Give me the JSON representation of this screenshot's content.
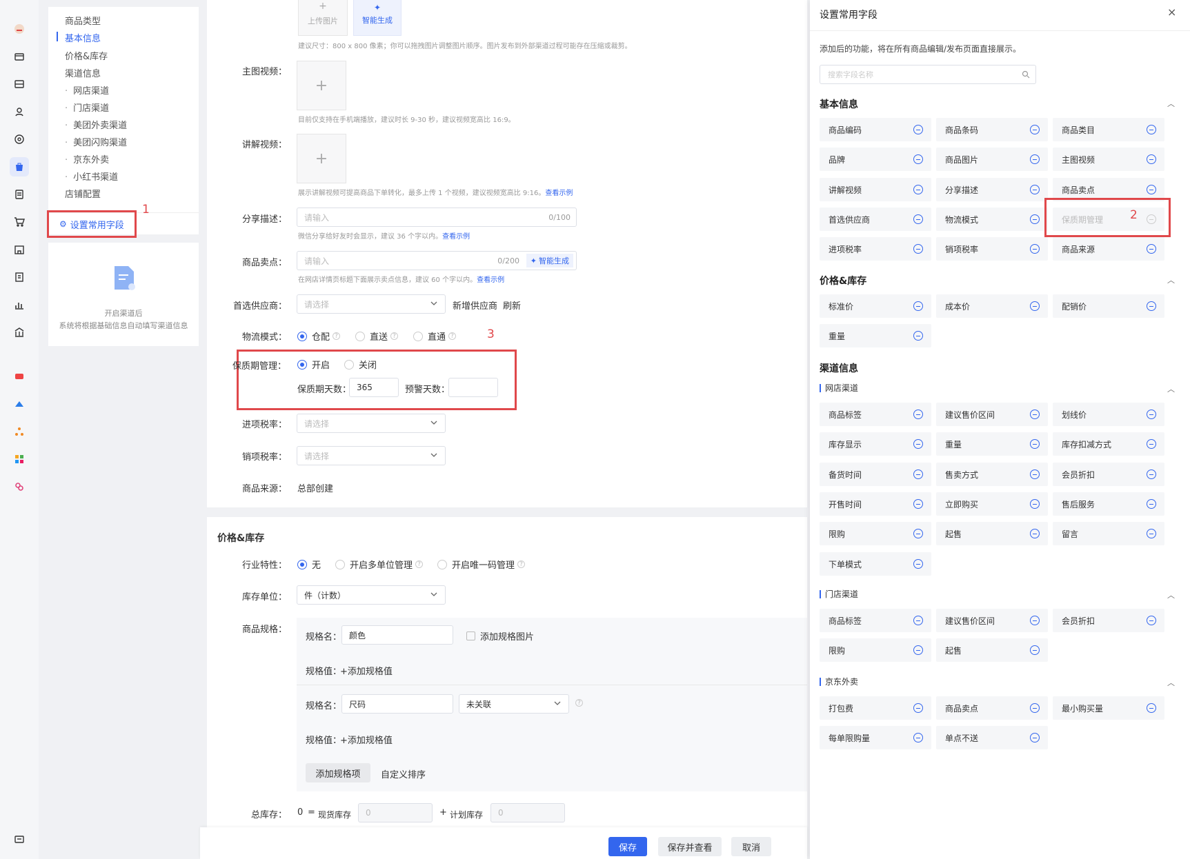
{
  "rail_icons": [
    "avatar",
    "store-icon",
    "shop-icon",
    "user-icon",
    "target-icon",
    "bag-icon",
    "doc-icon",
    "cart-icon",
    "building-icon",
    "receipt-icon",
    "chart-icon",
    "bank-icon",
    "app-red-icon",
    "app-blue-icon",
    "app-orange-icon",
    "app-multi-icon",
    "app-pink-icon",
    "chat-icon"
  ],
  "nav": {
    "items": [
      "商品类型",
      "基本信息",
      "价格&库存",
      "渠道信息"
    ],
    "subitems": [
      "网店渠道",
      "门店渠道",
      "美团外卖渠道",
      "美团闪购渠道",
      "京东外卖",
      "小红书渠道"
    ],
    "last": "店铺配置",
    "set_fields": "设置常用字段",
    "hint_line1": "开启渠道后",
    "hint_line2": "系统将根据基础信息自动填写渠道信息"
  },
  "annotations": {
    "n1": "1",
    "n2": "2",
    "n3": "3"
  },
  "form": {
    "upload_label": "上传图片",
    "ai_gen_label": "智能生成",
    "img_hint": "建议尺寸：800 x 800 像素；你可以拖拽图片调整图片顺序。图片发布到外部渠道过程可能存在压缩或裁剪。",
    "main_video_label": "主图视频：",
    "main_video_hint": "目前仅支持在手机端播放，建议时长 9-30 秒，建议视频宽高比 16:9。",
    "explain_video_label": "讲解视频：",
    "explain_video_hint": "展示讲解视频可提高商品下单转化，最多上传 1 个视频，建议视频宽高比 9:16。",
    "view_example": "查看示例",
    "share_label": "分享描述：",
    "share_placeholder": "请输入",
    "share_count": "0/100",
    "share_hint": "微信分享给好友时会显示，建议 36 个字以内。",
    "selling_label": "商品卖点：",
    "selling_placeholder": "请输入",
    "selling_count": "0/200",
    "selling_ai": "智能生成",
    "selling_hint": "在网店详情页标题下面展示卖点信息，建议 60 个字以内。",
    "supplier_label": "首选供应商：",
    "supplier_placeholder": "请选择",
    "add_supplier": "新增供应商",
    "refresh": "刷新",
    "logistics_label": "物流模式：",
    "logistics_opts": [
      "仓配",
      "直送",
      "直通"
    ],
    "shelf_label": "保质期管理：",
    "shelf_on": "开启",
    "shelf_off": "关闭",
    "shelf_days_label": "保质期天数：",
    "shelf_days_value": "365",
    "warn_days_label": "预警天数：",
    "in_tax_label": "进项税率：",
    "out_tax_label": "销项税率：",
    "tax_placeholder": "请选择",
    "source_label": "商品来源：",
    "source_value": "总部创建"
  },
  "price": {
    "section_title": "价格&库存",
    "industry_label": "行业特性：",
    "industry_opts": [
      "无",
      "开启多单位管理",
      "开启唯一码管理"
    ],
    "unit_label": "库存单位：",
    "unit_value": "件（计数）",
    "spec_label": "商品规格：",
    "spec_name_label": "规格名：",
    "spec1_name": "颜色",
    "add_spec_img": "添加规格图片",
    "spec_value_label": "规格值：",
    "add_spec_value": "+添加规格值",
    "spec2_name": "尺码",
    "spec2_link": "未关联",
    "add_spec_item": "添加规格项",
    "custom_sort": "自定义排序",
    "total_stock_label": "总库存：",
    "total_stock_value": "0",
    "eq": "=",
    "current_stock": "现货库存",
    "plus": "+",
    "planned_stock": "计划库存",
    "zero_placeholder": "0"
  },
  "footer": {
    "save": "保存",
    "save_view": "保存并查看",
    "cancel": "取消"
  },
  "drawer": {
    "title": "设置常用字段",
    "close": "×",
    "desc": "添加后的功能，将在所有商品编辑/发布页面直接展示。",
    "search_placeholder": "搜索字段名称",
    "sections": [
      {
        "title": "基本信息",
        "fields": [
          "商品编码",
          "商品条码",
          "商品类目",
          "品牌",
          "商品图片",
          "主图视频",
          "讲解视频",
          "分享描述",
          "商品卖点",
          "首选供应商",
          "物流模式",
          "保质期管理",
          "进项税率",
          "销项税率",
          "商品来源"
        ]
      },
      {
        "title": "价格&库存",
        "fields": [
          "标准价",
          "成本价",
          "配销价",
          "重量"
        ]
      },
      {
        "title": "渠道信息",
        "fields": []
      }
    ],
    "channels": [
      {
        "title": "网店渠道",
        "fields": [
          "商品标签",
          "建议售价区间",
          "划线价",
          "库存显示",
          "重量",
          "库存扣减方式",
          "备货时间",
          "售卖方式",
          "会员折扣",
          "开售时间",
          "立即购买",
          "售后服务",
          "限购",
          "起售",
          "留言",
          "下单模式"
        ]
      },
      {
        "title": "门店渠道",
        "fields": [
          "商品标签",
          "建议售价区间",
          "会员折扣",
          "限购",
          "起售"
        ]
      },
      {
        "title": "京东外卖",
        "fields": [
          "打包费",
          "商品卖点",
          "最小购买量",
          "每单限购量",
          "单点不送"
        ]
      }
    ]
  },
  "colors": {
    "accent": "#3366ee",
    "annotation_red": "#e0484b"
  }
}
